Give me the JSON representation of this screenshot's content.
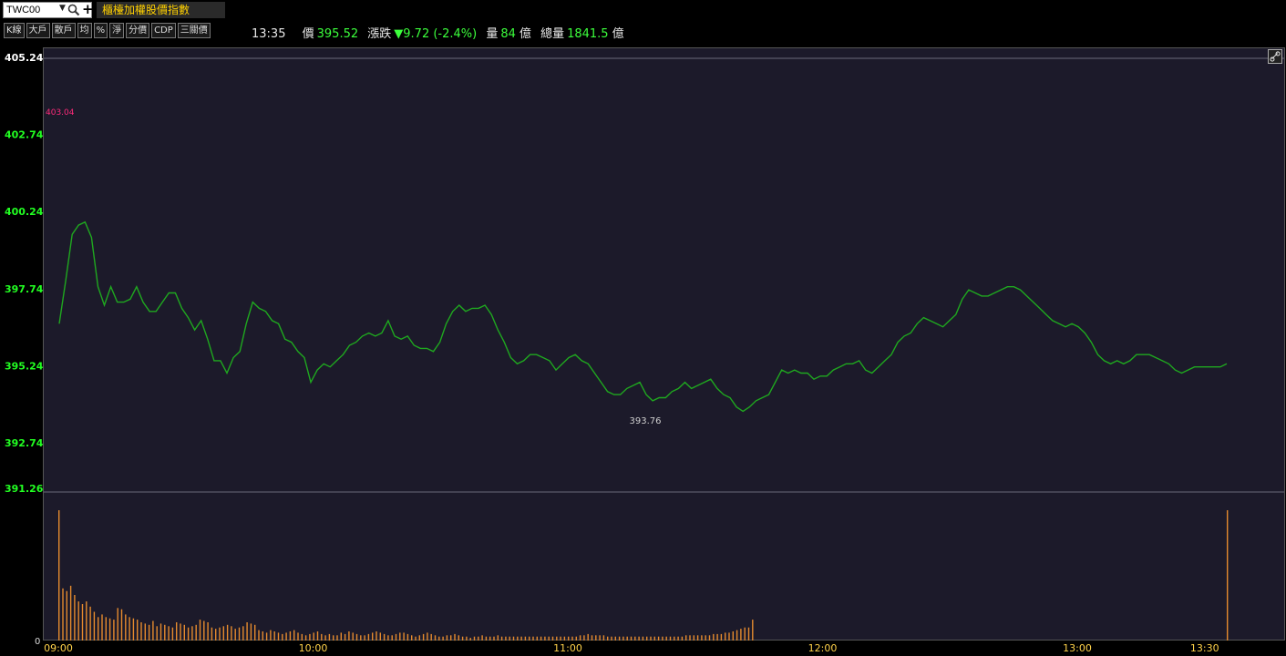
{
  "header": {
    "symbol": "TWC00",
    "title": "櫃檯加權股價指數",
    "toolbar": [
      "K線",
      "大戶",
      "散戶",
      "均",
      "%",
      "淨",
      "分價",
      "CDP",
      "三關價"
    ],
    "time": "13:35",
    "price_label": "價",
    "price_value": "395.52",
    "change_label": "漲跌",
    "change_value": "▼9.72 (-2.4%)",
    "volume_label": "量",
    "volume_value": "84",
    "volume_unit": "億",
    "total_label": "總量",
    "total_value": "1841.5",
    "total_unit": "億"
  },
  "icons": {
    "search": "search-icon",
    "dropdown": "chevron-down-icon",
    "add": "plus-icon",
    "link": "link-icon"
  },
  "colors": {
    "price_line": "#1fa81f",
    "volume_bar": "#e58a2e",
    "axis_label": "#22ff22",
    "high_label": "#ff2a7a",
    "background": "#1c1a2a"
  },
  "chart_data": {
    "type": "line",
    "y_ticks": [
      "405.24",
      "402.74",
      "400.24",
      "397.74",
      "395.24",
      "392.74",
      "391.26"
    ],
    "y_range": [
      391.26,
      405.24
    ],
    "x_ticks": [
      "09:00",
      "10:00",
      "11:00",
      "12:00",
      "13:00",
      "13:30"
    ],
    "high_label": "403.04",
    "low_label": "393.76",
    "volume_zero": "0",
    "price_series": [
      396.6,
      398.0,
      399.5,
      399.8,
      399.9,
      399.4,
      397.8,
      397.2,
      397.8,
      397.3,
      397.3,
      397.4,
      397.8,
      397.3,
      397.0,
      397.0,
      397.3,
      397.6,
      397.6,
      397.1,
      396.8,
      396.4,
      396.7,
      396.1,
      395.4,
      395.4,
      395.0,
      395.5,
      395.7,
      396.6,
      397.3,
      397.1,
      397.0,
      396.7,
      396.6,
      396.1,
      396.0,
      395.7,
      395.5,
      394.7,
      395.1,
      395.3,
      395.2,
      395.4,
      395.6,
      395.9,
      396.0,
      396.2,
      396.3,
      396.2,
      396.3,
      396.7,
      396.2,
      396.1,
      396.2,
      395.9,
      395.8,
      395.8,
      395.7,
      396.0,
      396.6,
      397.0,
      397.2,
      397.0,
      397.1,
      397.1,
      397.2,
      396.9,
      396.4,
      396.0,
      395.5,
      395.3,
      395.4,
      395.6,
      395.6,
      395.5,
      395.4,
      395.1,
      395.3,
      395.5,
      395.6,
      395.4,
      395.3,
      395.0,
      394.7,
      394.4,
      394.3,
      394.3,
      394.5,
      394.6,
      394.7,
      394.3,
      394.1,
      394.2,
      394.2,
      394.4,
      394.5,
      394.7,
      394.5,
      394.6,
      394.7,
      394.8,
      394.5,
      394.3,
      394.2,
      393.9,
      393.76,
      393.9,
      394.1,
      394.2,
      394.3,
      394.7,
      395.1,
      395.0,
      395.1,
      395.0,
      395.0,
      394.8,
      394.9,
      394.9,
      395.1,
      395.2,
      395.3,
      395.3,
      395.4,
      395.1,
      395.0,
      395.2,
      395.4,
      395.6,
      396.0,
      396.2,
      396.3,
      396.6,
      396.8,
      396.7,
      396.6,
      396.5,
      396.7,
      396.9,
      397.4,
      397.7,
      397.6,
      397.5,
      397.5,
      397.6,
      397.7,
      397.8,
      397.8,
      397.7,
      397.5,
      397.3,
      397.1,
      396.9,
      396.7,
      396.6,
      396.5,
      396.6,
      396.5,
      396.3,
      396.0,
      395.6,
      395.4,
      395.3,
      395.4,
      395.3,
      395.4,
      395.6,
      395.6,
      395.6,
      395.5,
      395.4,
      395.3,
      395.1,
      395.0,
      395.1,
      395.2,
      395.2,
      395.2,
      395.2,
      395.2,
      395.3
    ],
    "volume_series": [
      100,
      40,
      38,
      42,
      35,
      30,
      28,
      30,
      26,
      22,
      18,
      20,
      18,
      17,
      16,
      25,
      24,
      20,
      18,
      17,
      16,
      14,
      13,
      12,
      15,
      11,
      13,
      12,
      11,
      10,
      14,
      13,
      12,
      10,
      11,
      12,
      16,
      15,
      14,
      10,
      9,
      10,
      11,
      12,
      11,
      9,
      10,
      11,
      14,
      13,
      12,
      8,
      7,
      6,
      8,
      7,
      6,
      5,
      6,
      7,
      8,
      6,
      5,
      4,
      5,
      6,
      7,
      5,
      4,
      5,
      4,
      4,
      6,
      5,
      7,
      6,
      5,
      4,
      4,
      5,
      6,
      7,
      6,
      5,
      4,
      4,
      5,
      6,
      6,
      5,
      4,
      3,
      4,
      5,
      6,
      5,
      4,
      3,
      3,
      4,
      4,
      5,
      4,
      3,
      3,
      2,
      3,
      3,
      4,
      3,
      3,
      3,
      4,
      3,
      3,
      3,
      3,
      3,
      3,
      3,
      3,
      3,
      3,
      3,
      3,
      3,
      3,
      3,
      3,
      3,
      3,
      3,
      3,
      4,
      4,
      5,
      4,
      4,
      4,
      4,
      3,
      3,
      3,
      3,
      3,
      3,
      3,
      3,
      3,
      3,
      3,
      3,
      3,
      3,
      3,
      3,
      3,
      3,
      3,
      3,
      4,
      4,
      4,
      4,
      4,
      4,
      4,
      5,
      5,
      5,
      6,
      6,
      7,
      8,
      9,
      10,
      10,
      16,
      100,
      0,
      0,
      0,
      0,
      0
    ]
  }
}
